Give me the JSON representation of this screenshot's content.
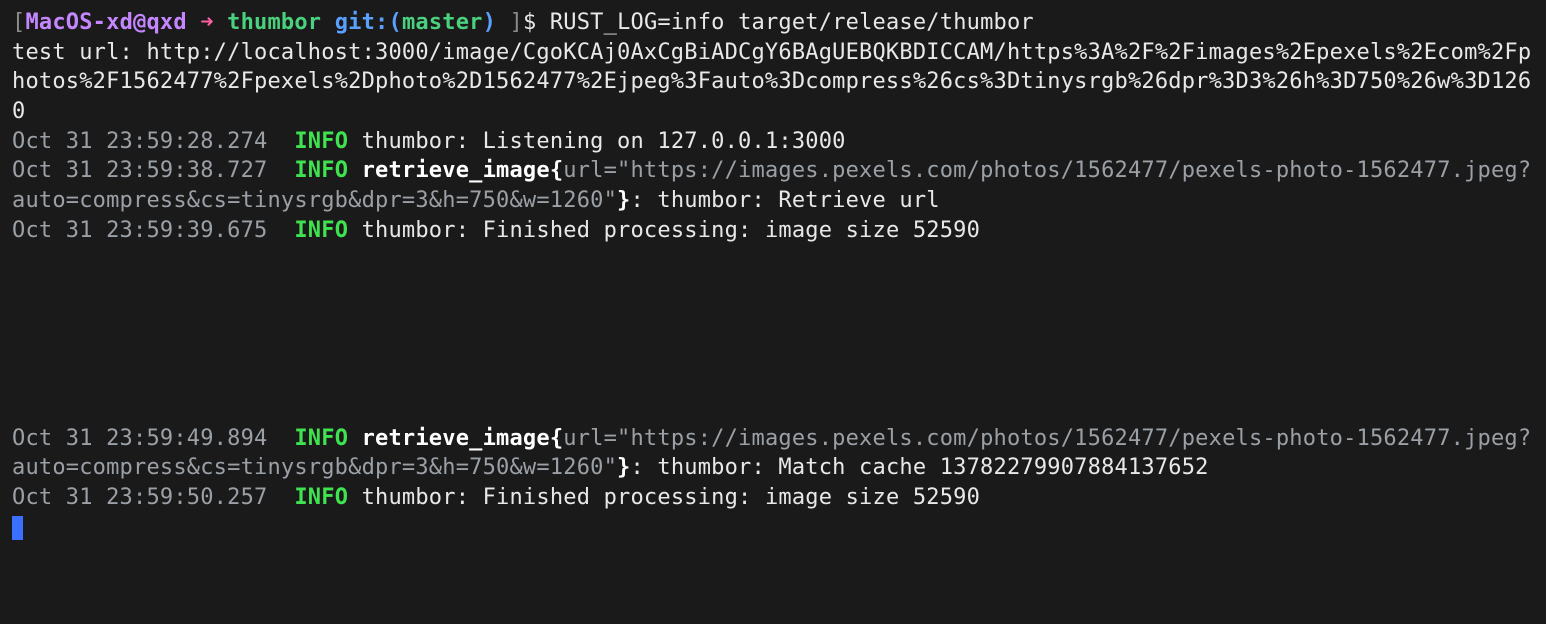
{
  "prompt": {
    "open_bracket": "[",
    "user_host": "MacOS-xd@qxd",
    "arrow": " ➜ ",
    "cwd": "thumbor ",
    "git_label": "git:(",
    "git_branch": "master",
    "git_close": ")",
    "close_bracket": " ]",
    "dollar": "$ ",
    "command": "RUST_LOG=info target/release/thumbor"
  },
  "lines": {
    "l1": "test url: http://localhost:3000/image/CgoKCAj0AxCgBiADCgY6BAgUEBQKBDICCAM/https%3A%2F%2Fimages%2Epexels%2Ecom%2Fphotos%2F1562477%2Fpexels%2Dphoto%2D1562477%2Ejpeg%3Fauto%3Dcompress%26cs%3Dtinysrgb%26dpr%3D3%26h%3D750%26w%3D1260"
  },
  "log1": {
    "ts": "Oct 31 23:59:28.274  ",
    "level": "INFO",
    "msg": " thumbor: Listening on 127.0.0.1:3000"
  },
  "log2": {
    "ts": "Oct 31 23:59:38.727  ",
    "level": "INFO",
    "span": " retrieve_image{",
    "args": "url=\"https://images.pexels.com/photos/1562477/pexels-photo-1562477.jpeg?auto=compress&cs=tinysrgb&dpr=3&h=750&w=1260\"",
    "close": "}",
    "rest": ": thumbor: Retrieve url"
  },
  "log3": {
    "ts": "Oct 31 23:59:39.675  ",
    "level": "INFO",
    "msg": " thumbor: Finished processing: image size 52590"
  },
  "log4": {
    "ts": "Oct 31 23:59:49.894  ",
    "level": "INFO",
    "span": " retrieve_image{",
    "args": "url=\"https://images.pexels.com/photos/1562477/pexels-photo-1562477.jpeg?auto=compress&cs=tinysrgb&dpr=3&h=750&w=1260\"",
    "close": "}",
    "rest": ": thumbor: Match cache 13782279907884137652"
  },
  "log5": {
    "ts": "Oct 31 23:59:50.257  ",
    "level": "INFO",
    "msg": " thumbor: Finished processing: image size 52590"
  }
}
